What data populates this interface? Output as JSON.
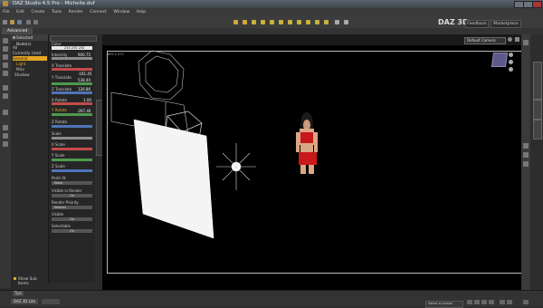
{
  "window": {
    "title": "DAZ Studio 4.5 Pro - Michelle.duf"
  },
  "menu": {
    "items": [
      "File",
      "Edit",
      "Create",
      "Tools",
      "Render",
      "Connect",
      "Window",
      "Help"
    ]
  },
  "top_buttons": {
    "feedback": "Feedback",
    "marketplace": "Marketplace",
    "brand": "DAZ 3D"
  },
  "tabs": {
    "active": "Advanced"
  },
  "left_panel": {
    "header": "Selected Node(s)",
    "items": [
      "All",
      "Currently Used",
      "General",
      "Light",
      "Misc",
      "Shadow"
    ],
    "footer": "Show Sub Items",
    "tips_tab": "Tips"
  },
  "params": {
    "fields": [
      {
        "label": "Color",
        "value": "255  255  255",
        "color": "#e8e8e8"
      },
      {
        "label": "Intensity",
        "value": "900.75",
        "color": "#8c8c8c"
      },
      {
        "label": "X Translate",
        "value": "-161.45",
        "color": "#c34b4b"
      },
      {
        "label": "Y Translate",
        "value": "538.40",
        "color": "#4f9a4f"
      },
      {
        "label": "Z Translate",
        "value": "126.86",
        "color": "#5074b8"
      },
      {
        "label": "X Rotate",
        "value": "1.00",
        "color": "#c34b4b"
      },
      {
        "label": "Y Rotate",
        "value": "-267.40",
        "color": "#4f9a4f"
      },
      {
        "label": "Z Rotate",
        "value": "",
        "color": "#5074b8"
      },
      {
        "label": "Scale",
        "value": "",
        "color": "#8c8c8c"
      },
      {
        "label": "X Scale",
        "value": "",
        "color": "#c34b4b"
      },
      {
        "label": "Y Scale",
        "value": "",
        "color": "#4f9a4f"
      },
      {
        "label": "Z Scale",
        "value": "",
        "color": "#5074b8"
      },
      {
        "label": "Point At",
        "value": "None",
        "color": "#8c8c8c"
      },
      {
        "label": "Visible in Render",
        "value": "On",
        "color": "#8c8c8c"
      },
      {
        "label": "Render Priority",
        "value": "Normal",
        "color": "#8c8c8c"
      },
      {
        "label": "Visible",
        "value": "On",
        "color": "#8c8c8c"
      },
      {
        "label": "Selectable",
        "value": "On",
        "color": "#8c8c8c"
      }
    ]
  },
  "viewport": {
    "camera_select": "Default Camera",
    "resolution": "895 x 473",
    "view_cube_color": "#5d5a8a"
  },
  "right_tabs": [
    "Smart Content",
    "Lights",
    "Surfaces"
  ],
  "bottom": {
    "tab1": "DAZ 3D Lite",
    "select_lesson": "Select a Lesson"
  }
}
